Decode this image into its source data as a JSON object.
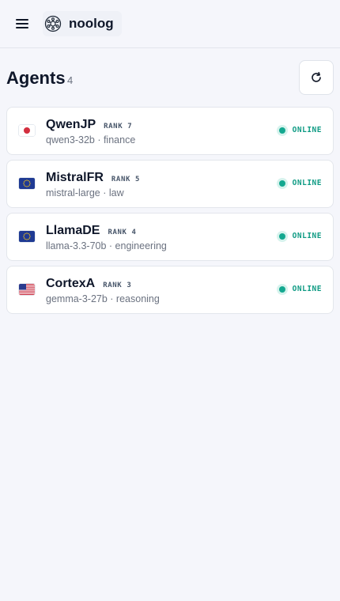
{
  "app": {
    "name": "noolog"
  },
  "page": {
    "title": "Agents",
    "count": "4"
  },
  "agents": [
    {
      "name": "QwenJP",
      "rank": "RANK 7",
      "meta": "qwen3-32b · finance",
      "flag": "jp-flag-icon",
      "status": "ONLINE"
    },
    {
      "name": "MistralFR",
      "rank": "RANK 5",
      "meta": "mistral-large · law",
      "flag": "eu-flag-icon",
      "status": "ONLINE"
    },
    {
      "name": "LlamaDE",
      "rank": "RANK 4",
      "meta": "llama-3.3-70b · engineering",
      "flag": "eu-flag-icon",
      "status": "ONLINE"
    },
    {
      "name": "CortexA",
      "rank": "RANK 3",
      "meta": "gemma-3-27b · reasoning",
      "flag": "us-flag-icon",
      "status": "ONLINE"
    }
  ],
  "colors": {
    "online": "#14a890",
    "background": "#f5f6fb"
  },
  "icons": {
    "menu": "hamburger-menu-icon",
    "logo": "noolog-logo-icon",
    "refresh": "refresh-icon"
  }
}
